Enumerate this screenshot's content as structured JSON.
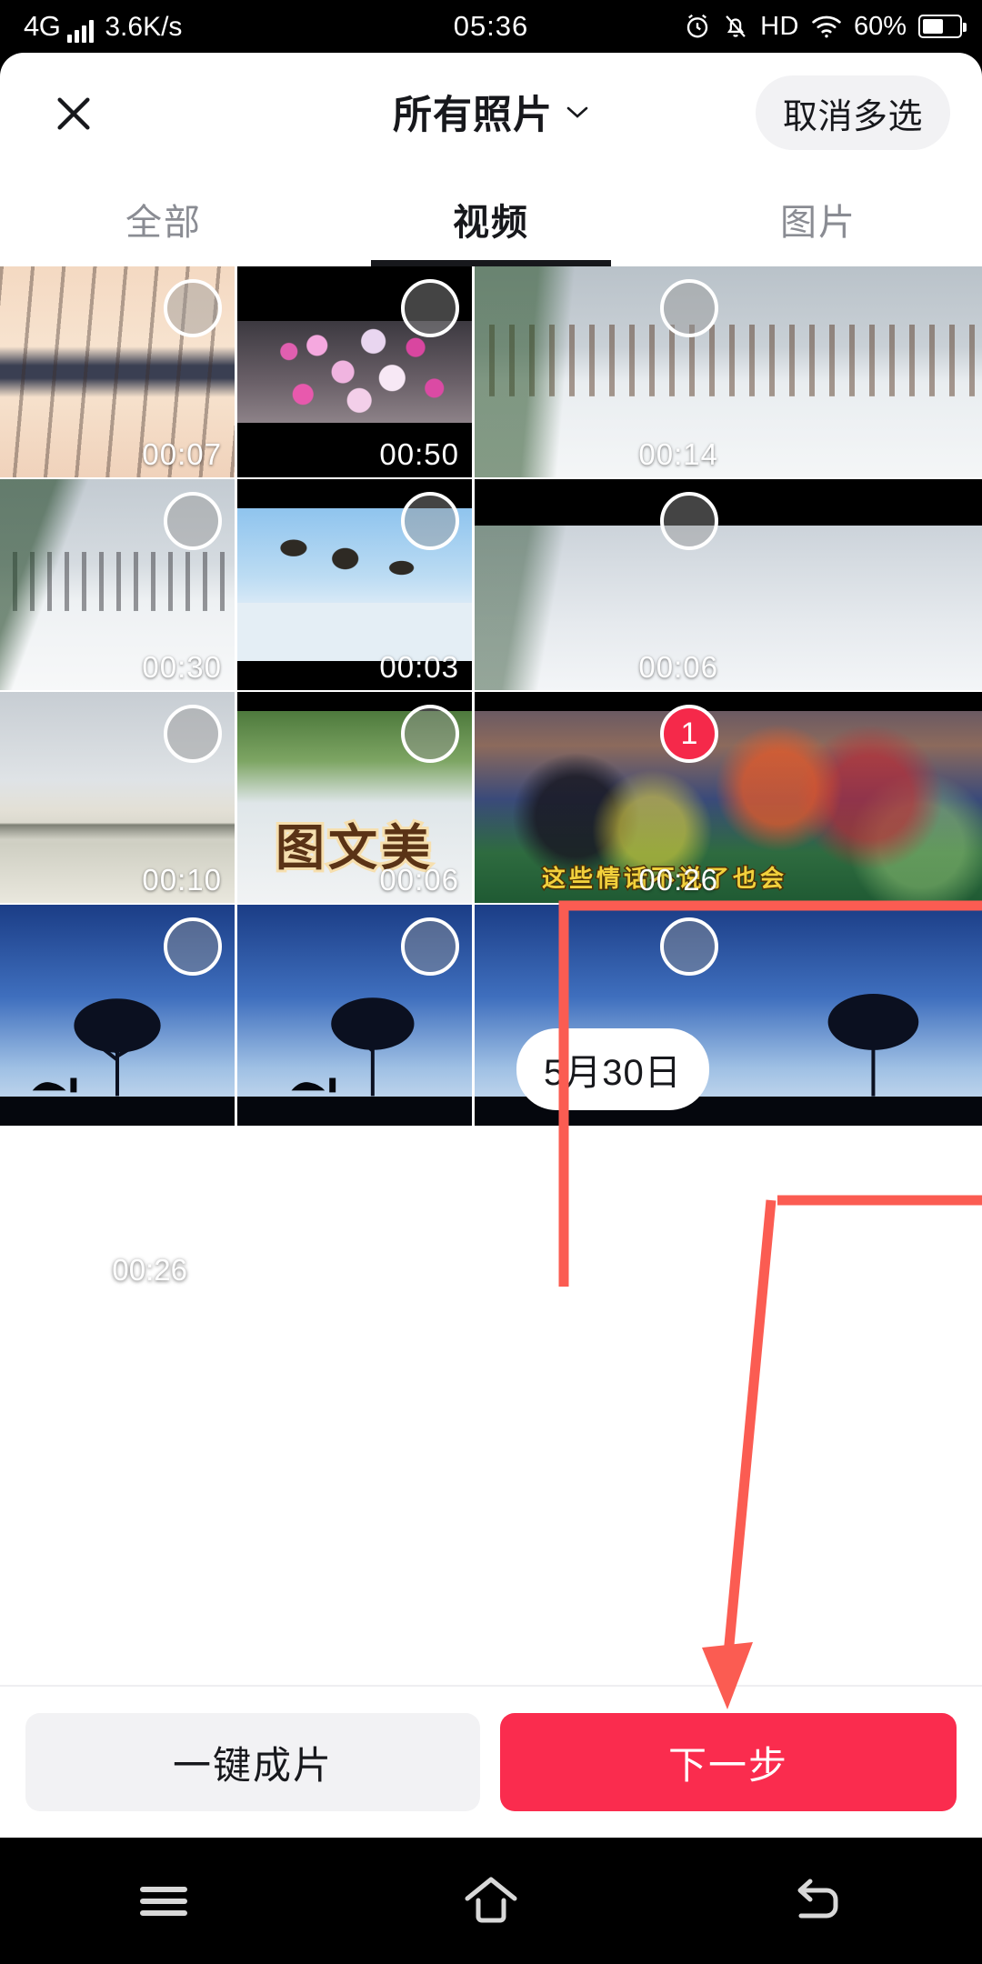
{
  "status_bar": {
    "network": "4G",
    "speed": "3.6K/s",
    "time": "05:36",
    "hd": "HD",
    "battery_percent": "60%",
    "icons": [
      "signal-icon",
      "alarm-icon",
      "mute-bell-icon",
      "hd-icon",
      "wifi-icon",
      "battery-icon"
    ]
  },
  "header": {
    "close_label": "✕",
    "title": "所有照片",
    "chevron": "chevron-down-icon",
    "multiselect_label": "取消多选"
  },
  "tabs": [
    {
      "label": "全部",
      "active": false
    },
    {
      "label": "视频",
      "active": true
    },
    {
      "label": "图片",
      "active": false
    }
  ],
  "grid": {
    "date_badge": "5月30日",
    "items": [
      {
        "duration": "00:07",
        "selected": false,
        "badge": ""
      },
      {
        "duration": "00:50",
        "selected": false,
        "badge": ""
      },
      {
        "duration": "00:14",
        "selected": false,
        "badge": ""
      },
      {
        "duration": "00:30",
        "selected": false,
        "badge": ""
      },
      {
        "duration": "00:03",
        "selected": false,
        "badge": ""
      },
      {
        "duration": "00:06",
        "selected": false,
        "badge": ""
      },
      {
        "duration": "00:10",
        "selected": false,
        "badge": ""
      },
      {
        "duration": "00:06",
        "selected": false,
        "badge": ""
      },
      {
        "duration": "00:26",
        "selected": true,
        "badge": "1"
      },
      {
        "duration": "",
        "selected": false,
        "badge": ""
      },
      {
        "duration": "",
        "selected": false,
        "badge": ""
      },
      {
        "duration": "",
        "selected": false,
        "badge": ""
      }
    ],
    "overlay_text": "图文美",
    "overlay_caption": "这些情话不说了也会"
  },
  "selected_strip": {
    "duration": "00:26",
    "remove_label": "✕"
  },
  "bottom_actions": {
    "secondary_label": "一键成片",
    "primary_label": "下一步"
  },
  "navbar": {
    "items": [
      "menu-icon",
      "home-icon",
      "back-icon"
    ]
  },
  "colors": {
    "accent_red": "#fa2c4e",
    "badge_red": "#f5294a",
    "annotation_red": "#fb5c52",
    "ghost_bg": "#f2f2f4",
    "text_dark": "#17181c",
    "text_muted": "#8a8c93"
  }
}
